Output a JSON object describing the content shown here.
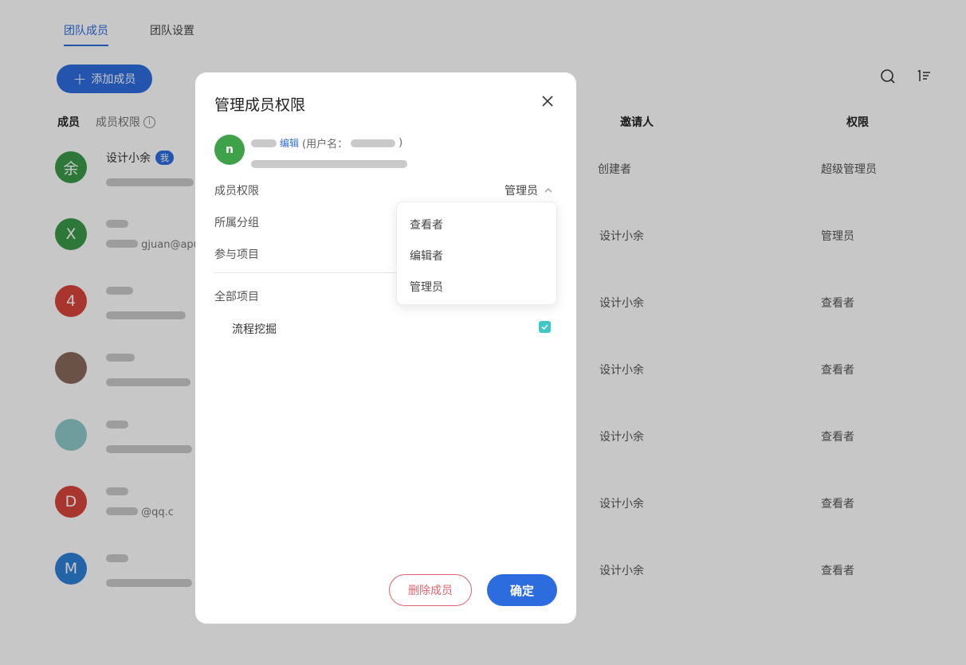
{
  "tabs": [
    {
      "label": "团队成员",
      "active": true
    },
    {
      "label": "团队设置",
      "active": false
    }
  ],
  "toolbar": {
    "add_member_label": "添加成员",
    "search_icon": "search-icon",
    "sort_icon": "sort-icon"
  },
  "table": {
    "headers": {
      "member": "成员",
      "member_permission": "成员权限",
      "inviter": "邀请人",
      "permission": "权限"
    },
    "rows": [
      {
        "avatar_text": "余",
        "avatar_color": "#3a9a4a",
        "name": "设计小余",
        "badge": "我",
        "inviter": "创建者",
        "permission": "超级管理员"
      },
      {
        "avatar_text": "X",
        "avatar_color": "#3a9a4a",
        "name": "",
        "email_visible": "gjuan@apu",
        "inviter": "设计小余",
        "permission": "管理员"
      },
      {
        "avatar_text": "4",
        "avatar_color": "#d9463c",
        "name": "",
        "inviter": "设计小余",
        "permission": "查看者"
      },
      {
        "avatar_text": "",
        "avatar_color": "#8a6a5a",
        "name": "",
        "inviter": "设计小余",
        "permission": "查看者"
      },
      {
        "avatar_text": "",
        "avatar_color": "#8fc9c9",
        "name": "",
        "inviter": "设计小余",
        "permission": "查看者"
      },
      {
        "avatar_text": "D",
        "avatar_color": "#d9463c",
        "name": "",
        "email_visible": "@qq.c",
        "inviter": "设计小余",
        "permission": "查看者"
      },
      {
        "avatar_text": "M",
        "avatar_color": "#2d7fd6",
        "name": "",
        "inviter": "设计小余",
        "permission": "查看者"
      }
    ]
  },
  "modal": {
    "title": "管理成员权限",
    "member": {
      "avatar_text": "n",
      "edit_label": "编辑",
      "username_prefix": "(用户名：",
      "username_suffix": ")"
    },
    "labels": {
      "permission": "成员权限",
      "group": "所属分组",
      "projects": "参与项目",
      "all_projects": "全部项目"
    },
    "permission_value": "管理员",
    "dropdown_options": [
      "查看者",
      "编辑者",
      "管理员"
    ],
    "project_item": "流程挖掘",
    "project_checked": true,
    "delete_label": "删除成员",
    "confirm_label": "确定"
  },
  "colors": {
    "primary": "#2d6cdf",
    "danger": "#e3626d",
    "check": "#3ec8c8"
  }
}
